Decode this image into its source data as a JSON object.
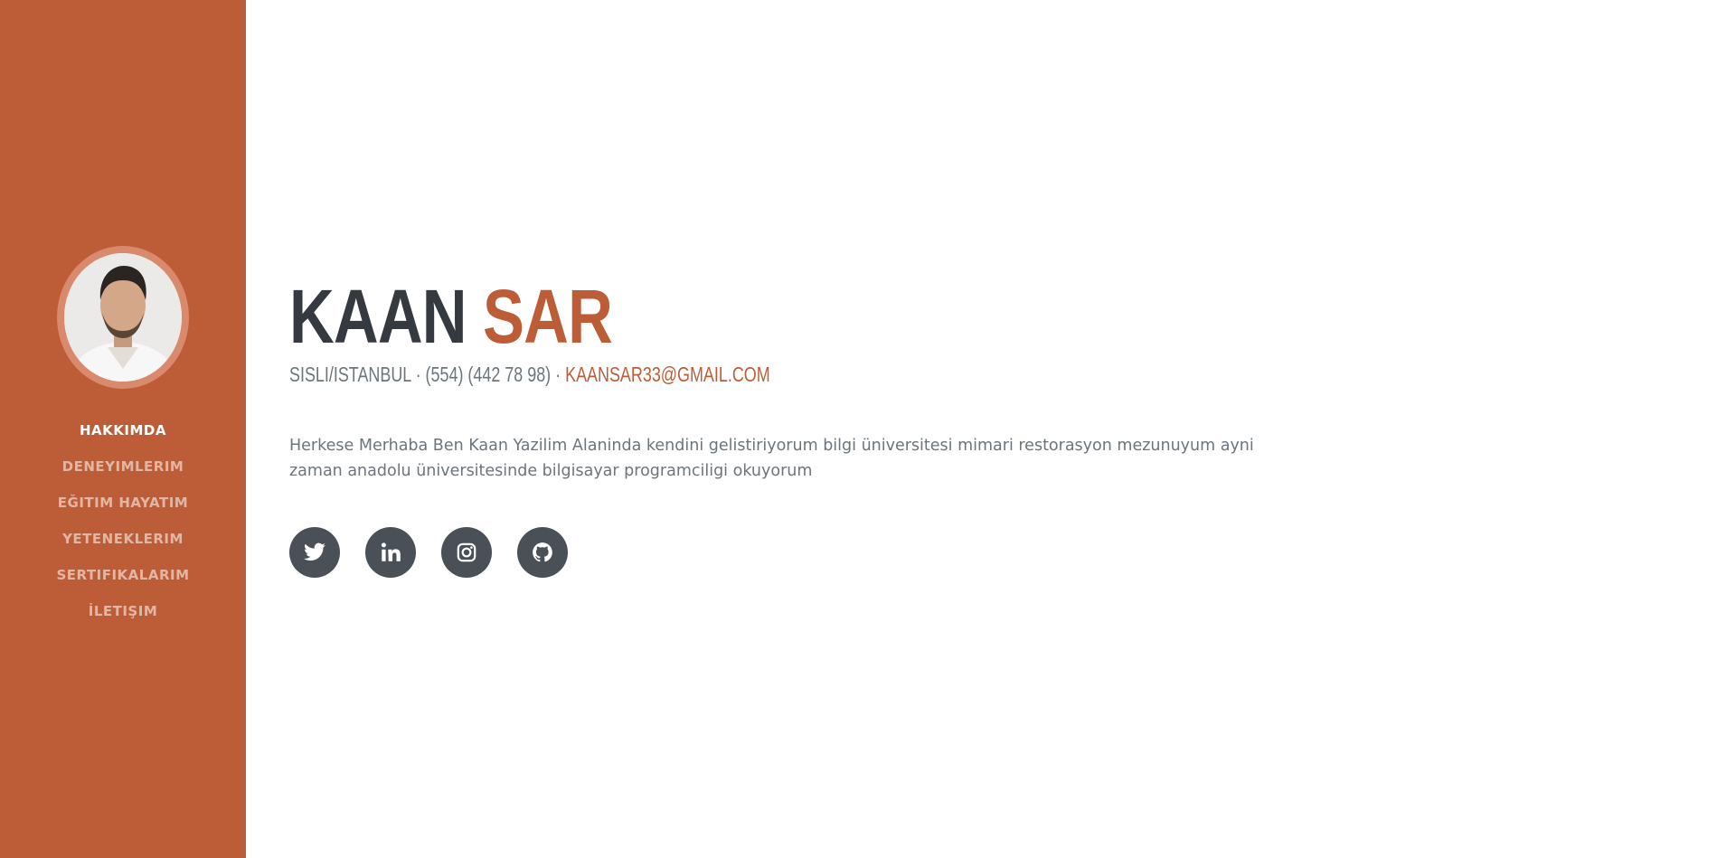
{
  "sidebar": {
    "accent_color": "#bd5d38",
    "avatar_alt": "profile-photo",
    "nav": [
      {
        "label": "HAKKIMDA",
        "active": true
      },
      {
        "label": "DENEYIMLERIM",
        "active": false
      },
      {
        "label": "EĞITIM HAYATIM",
        "active": false
      },
      {
        "label": "YETENEKLERIM",
        "active": false
      },
      {
        "label": "SERTIFIKALARIM",
        "active": false
      },
      {
        "label": "İLETIŞIM",
        "active": false
      }
    ]
  },
  "about": {
    "first_name": "KAAN",
    "last_name": "SAR",
    "location_phone": "SISLI/ISTANBUL · (554) (442 78 98) · ",
    "email": "KAANSAR33@GMAIL.COM",
    "description": "Herkese Merhaba Ben Kaan Yazilim Alaninda kendini gelistiriyorum bilgi üniversitesi mimari restorasyon mezunuyum ayni zaman anadolu üniversitesinde bilgisayar programciligi okuyorum"
  },
  "social": [
    {
      "icon": "twitter-icon"
    },
    {
      "icon": "linkedin-icon"
    },
    {
      "icon": "instagram-icon"
    },
    {
      "icon": "github-icon"
    }
  ]
}
